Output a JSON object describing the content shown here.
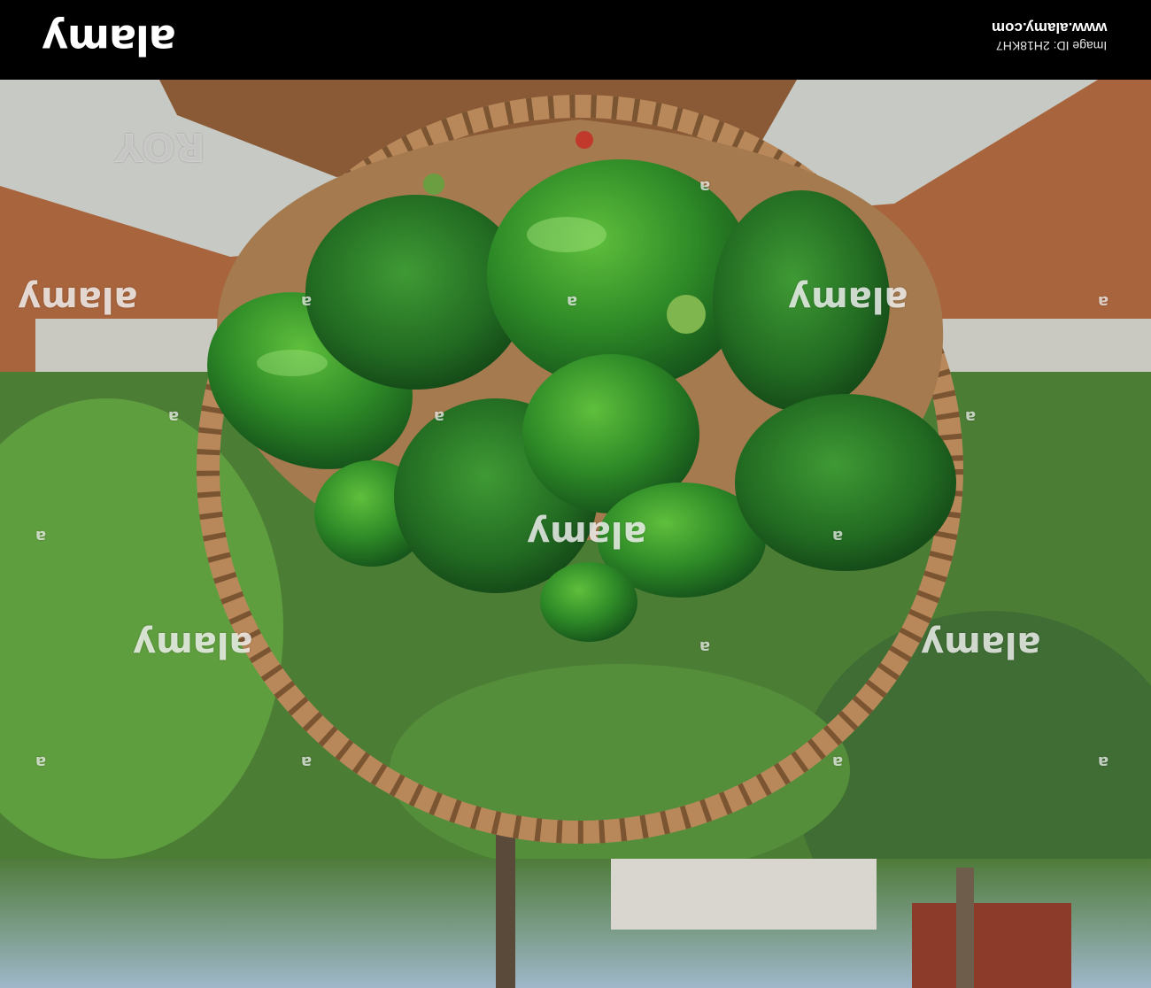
{
  "header": {
    "logo": "alamy",
    "site_url": "www.alamy.com",
    "image_id": "Image ID: 2H18KH7"
  },
  "watermark": {
    "brand": "alamy",
    "letter": "a",
    "roy": "ROY"
  },
  "colors": {
    "header_bg": "#000000",
    "pepper_green": "#2f8a2a",
    "basket": "#b8885a",
    "soil": "#9a5a35"
  }
}
